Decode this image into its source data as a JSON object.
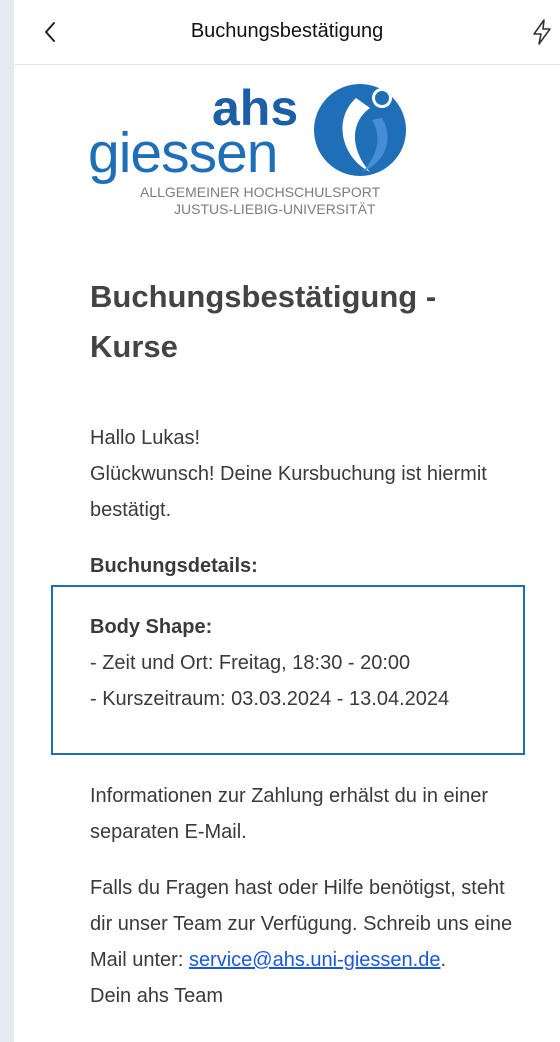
{
  "navbar": {
    "title": "Buchungsbestätigung",
    "back_icon": "chevron-left-icon",
    "action_icon": "lightning-icon"
  },
  "logo": {
    "brand_ahs": "ahs",
    "brand_giessen": "giessen",
    "line1": "ALLGEMEINER HOCHSCHULSPORT",
    "line2": "JUSTUS-LIEBIG-UNIVERSITÄT",
    "primary_color": "#1f6fb8",
    "secondary_color": "#4a90d9"
  },
  "email": {
    "heading": "Buchungsbestätigung - Kurse",
    "greeting_line1": "Hallo Lukas!",
    "greeting_line2": "Glückwunsch! Deine Kursbuchung ist hiermit bestätigt.",
    "details_label": "Buchungsdetails:",
    "course_name": "Body Shape:",
    "course_time_place": "- Zeit und Ort: Freitag, 18:30 - 20:00",
    "course_period": "- Kurszeitraum: 03.03.2024 - 13.04.2024",
    "payment_info": "Informationen zur Zahlung erhälst du in einer separaten E-Mail.",
    "help_text": "Falls du Fragen hast oder Hilfe benötigst, steht dir unser Team zur Verfügung. Schreib uns eine Mail unter: ",
    "help_email": "service@ahs.uni-giessen.de",
    "help_suffix": ".",
    "signature": "Dein ahs Team",
    "link_color": "#1a57e0",
    "box_border_color": "#1f6fb8"
  }
}
